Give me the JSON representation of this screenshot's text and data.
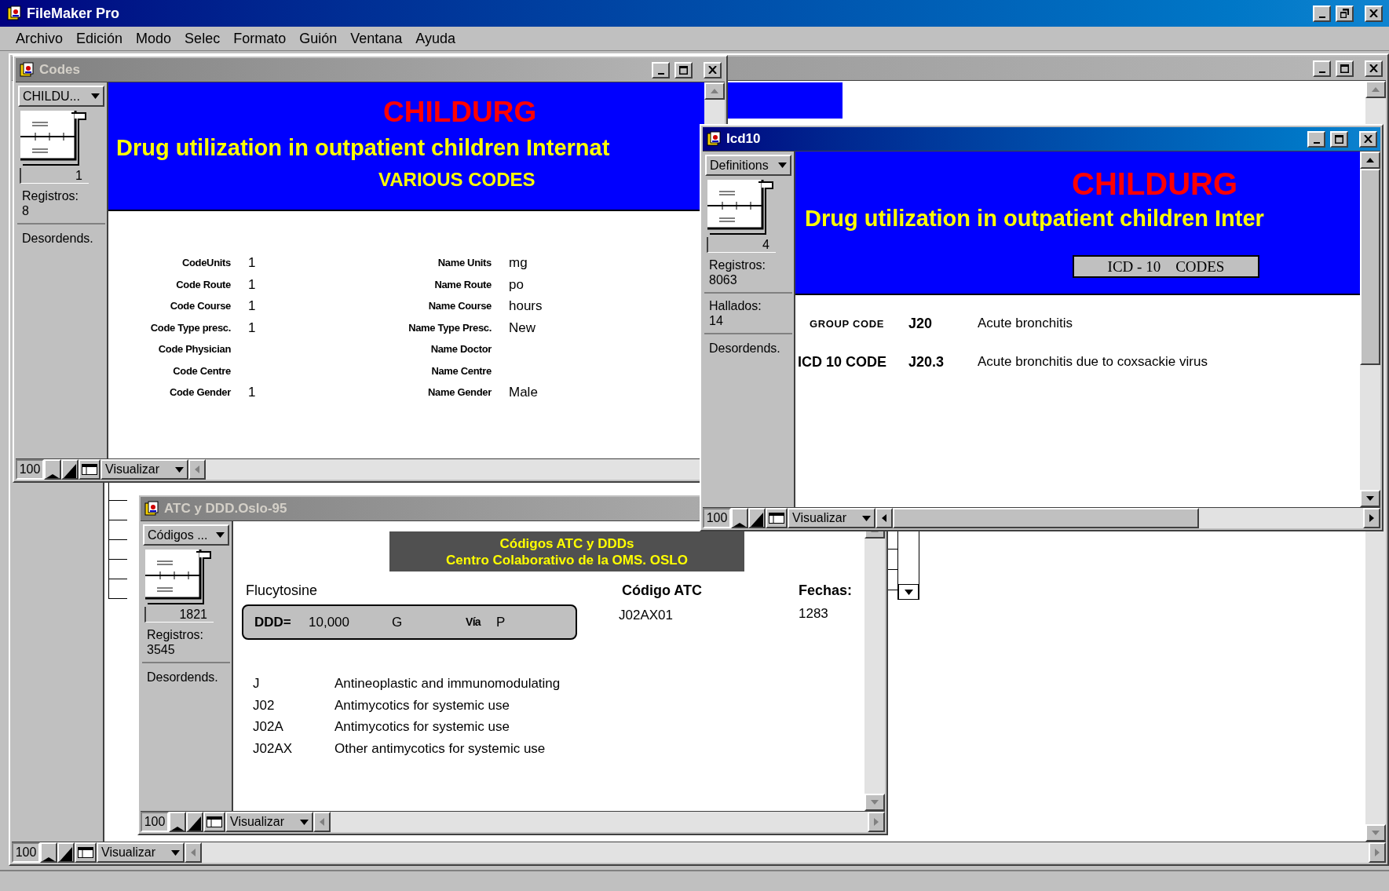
{
  "app": {
    "title": "FileMaker Pro"
  },
  "menu": [
    {
      "label": "Archivo"
    },
    {
      "label": "Edición"
    },
    {
      "label": "Modo"
    },
    {
      "label": "Selec"
    },
    {
      "label": "Formato"
    },
    {
      "label": "Guión"
    },
    {
      "label": "Ventana"
    },
    {
      "label": "Ayuda"
    }
  ],
  "windows": [
    {
      "kind": "icd10",
      "title": "Icd10",
      "active": true,
      "layout_menu": "Definitions",
      "record": "4",
      "status": [
        {
          "label": "Registros:",
          "value": "8063"
        },
        {
          "label": "Hallados:",
          "value": "14"
        }
      ],
      "sort": "Desordends.",
      "zoom": "100",
      "mode": "Visualizar",
      "header": {
        "title": "CHILDURG",
        "subtitle": "Drug utilization in outpatient children Inter",
        "badge": "ICD - 10    CODES"
      },
      "rows": [
        {
          "kind": "group",
          "label": "GROUP CODE",
          "code": "J20",
          "description": "Acute bronchitis"
        },
        {
          "kind": "detail",
          "label": "ICD 10 CODE",
          "code": "J20.3",
          "description": "Acute bronchitis due to coxsackie virus"
        }
      ]
    },
    {
      "kind": "codes",
      "title": "Codes",
      "active": false,
      "layout_menu": "CHILDU...",
      "record": "1",
      "status": [
        {
          "label": "Registros:",
          "value": "8"
        }
      ],
      "sort": "Desordends.",
      "zoom": "100",
      "mode": "Visualizar",
      "header": {
        "title": "CHILDURG",
        "subtitle": "Drug utilization in outpatient children Internat",
        "heading": "VARIOUS CODES"
      },
      "rows": [
        {
          "code_label": "CodeUnits",
          "code": "1",
          "name_label": "Name Units",
          "name": "mg"
        },
        {
          "code_label": "Code Route",
          "code": "1",
          "name_label": "Name Route",
          "name": "po"
        },
        {
          "code_label": "Code Course",
          "code": "1",
          "name_label": "Name Course",
          "name": "hours"
        },
        {
          "code_label": "Code Type presc.",
          "code": "1",
          "name_label": "Name Type Presc.",
          "name": "New"
        },
        {
          "code_label": "Code Physician",
          "name_label": "Name Doctor"
        },
        {
          "code_label": "Code Centre",
          "name_label": "Name Centre"
        },
        {
          "code_label": "Code Gender",
          "code": "1",
          "name_label": "Name Gender",
          "name": "Male"
        }
      ]
    },
    {
      "kind": "atc",
      "title": "ATC y DDD.Oslo-95",
      "active": false,
      "layout_menu": "Códigos ...",
      "record": "1821",
      "status": [
        {
          "label": "Registros:",
          "value": "3545"
        }
      ],
      "sort": "Desordends.",
      "zoom": "100",
      "mode": "Visualizar",
      "banner": [
        "Códigos ATC y DDDs",
        "Centro Colaborativo de la OMS. OSLO"
      ],
      "drug": "Flucytosine",
      "ddd": {
        "label": "DDD=",
        "value": "10,000",
        "unit": "G",
        "via_label": "Vía",
        "via": "P"
      },
      "atc": {
        "label": "Código ATC",
        "value": "J02AX01"
      },
      "dates": {
        "label": "Fechas:",
        "value": "1283"
      },
      "hierarchy": [
        {
          "code": "J",
          "description": "Antineoplastic and immunomodulating"
        },
        {
          "code": "J02",
          "description": "Antimycotics for systemic use"
        },
        {
          "code": "J02A",
          "description": "Antimycotics for systemic use"
        },
        {
          "code": "J02AX",
          "description": "Other antimycotics for systemic use"
        }
      ]
    },
    {
      "kind": "background",
      "active": false,
      "zoom": "100",
      "mode": "Visualizar"
    }
  ]
}
